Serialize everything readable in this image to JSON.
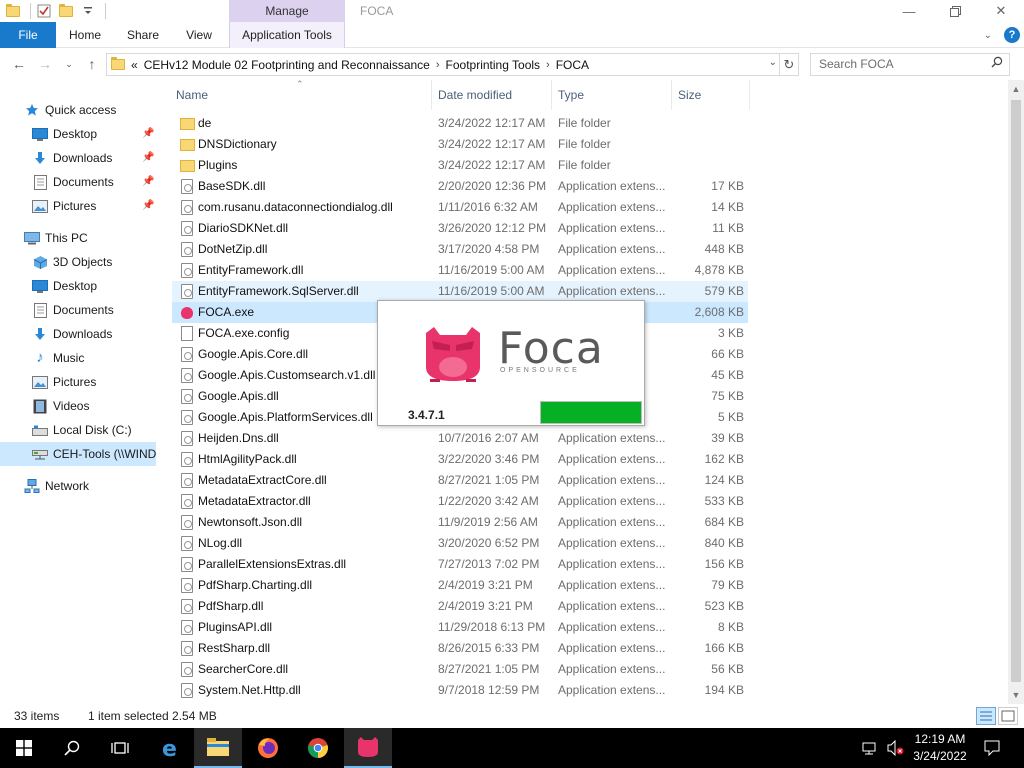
{
  "window": {
    "title": "FOCA",
    "manage_tab": "Manage",
    "controls": [
      "minimize-icon",
      "maximize-icon",
      "close-icon"
    ]
  },
  "ribbon": {
    "tabs": [
      "File",
      "Home",
      "Share",
      "View",
      "Application Tools"
    ]
  },
  "address": {
    "overflow": "«",
    "crumbs": [
      "CEHv12 Module 02 Footprinting and Reconnaissance",
      "Footprinting Tools",
      "FOCA"
    ],
    "search_placeholder": "Search FOCA"
  },
  "sidebar": {
    "quick_access": "Quick access",
    "quick_items": [
      "Desktop",
      "Downloads",
      "Documents",
      "Pictures"
    ],
    "this_pc": "This PC",
    "pc_items": [
      "3D Objects",
      "Desktop",
      "Documents",
      "Downloads",
      "Music",
      "Pictures",
      "Videos",
      "Local Disk (C:)",
      "CEH-Tools (\\\\WIND"
    ],
    "network": "Network"
  },
  "columns": [
    "Name",
    "Date modified",
    "Type",
    "Size"
  ],
  "files": [
    {
      "name": "de",
      "date": "3/24/2022 12:17 AM",
      "type": "File folder",
      "size": "",
      "kind": "folder"
    },
    {
      "name": "DNSDictionary",
      "date": "3/24/2022 12:17 AM",
      "type": "File folder",
      "size": "",
      "kind": "folder"
    },
    {
      "name": "Plugins",
      "date": "3/24/2022 12:17 AM",
      "type": "File folder",
      "size": "",
      "kind": "folder"
    },
    {
      "name": "BaseSDK.dll",
      "date": "2/20/2020 12:36 PM",
      "type": "Application extens...",
      "size": "17 KB",
      "kind": "dll"
    },
    {
      "name": "com.rusanu.dataconnectiondialog.dll",
      "date": "1/11/2016 6:32 AM",
      "type": "Application extens...",
      "size": "14 KB",
      "kind": "dll"
    },
    {
      "name": "DiarioSDKNet.dll",
      "date": "3/26/2020 12:12 PM",
      "type": "Application extens...",
      "size": "11 KB",
      "kind": "dll"
    },
    {
      "name": "DotNetZip.dll",
      "date": "3/17/2020 4:58 PM",
      "type": "Application extens...",
      "size": "448 KB",
      "kind": "dll"
    },
    {
      "name": "EntityFramework.dll",
      "date": "11/16/2019 5:00 AM",
      "type": "Application extens...",
      "size": "4,878 KB",
      "kind": "dll"
    },
    {
      "name": "EntityFramework.SqlServer.dll",
      "date": "11/16/2019 5:00 AM",
      "type": "Application extens...",
      "size": "579 KB",
      "kind": "dll",
      "state": "hover"
    },
    {
      "name": "FOCA.exe",
      "date": "",
      "type": "",
      "size": "2,608 KB",
      "kind": "exe",
      "state": "selected"
    },
    {
      "name": "FOCA.exe.config",
      "date": "",
      "type": "",
      "size": "3 KB",
      "kind": "config"
    },
    {
      "name": "Google.Apis.Core.dll",
      "date": "",
      "type": "ens...",
      "size": "66 KB",
      "kind": "dll"
    },
    {
      "name": "Google.Apis.Customsearch.v1.dll",
      "date": "",
      "type": "ens...",
      "size": "45 KB",
      "kind": "dll"
    },
    {
      "name": "Google.Apis.dll",
      "date": "",
      "type": "ens...",
      "size": "75 KB",
      "kind": "dll"
    },
    {
      "name": "Google.Apis.PlatformServices.dll",
      "date": "",
      "type": "ens...",
      "size": "5 KB",
      "kind": "dll"
    },
    {
      "name": "Heijden.Dns.dll",
      "date": "10/7/2016 2:07 AM",
      "type": "Application extens...",
      "size": "39 KB",
      "kind": "dll"
    },
    {
      "name": "HtmlAgilityPack.dll",
      "date": "3/22/2020 3:46 PM",
      "type": "Application extens...",
      "size": "162 KB",
      "kind": "dll"
    },
    {
      "name": "MetadataExtractCore.dll",
      "date": "8/27/2021 1:05 PM",
      "type": "Application extens...",
      "size": "124 KB",
      "kind": "dll"
    },
    {
      "name": "MetadataExtractor.dll",
      "date": "1/22/2020 3:42 AM",
      "type": "Application extens...",
      "size": "533 KB",
      "kind": "dll"
    },
    {
      "name": "Newtonsoft.Json.dll",
      "date": "11/9/2019 2:56 AM",
      "type": "Application extens...",
      "size": "684 KB",
      "kind": "dll"
    },
    {
      "name": "NLog.dll",
      "date": "3/20/2020 6:52 PM",
      "type": "Application extens...",
      "size": "840 KB",
      "kind": "dll"
    },
    {
      "name": "ParallelExtensionsExtras.dll",
      "date": "7/27/2013 7:02 PM",
      "type": "Application extens...",
      "size": "156 KB",
      "kind": "dll"
    },
    {
      "name": "PdfSharp.Charting.dll",
      "date": "2/4/2019 3:21 PM",
      "type": "Application extens...",
      "size": "79 KB",
      "kind": "dll"
    },
    {
      "name": "PdfSharp.dll",
      "date": "2/4/2019 3:21 PM",
      "type": "Application extens...",
      "size": "523 KB",
      "kind": "dll"
    },
    {
      "name": "PluginsAPI.dll",
      "date": "11/29/2018 6:13 PM",
      "type": "Application extens...",
      "size": "8 KB",
      "kind": "dll"
    },
    {
      "name": "RestSharp.dll",
      "date": "8/26/2015 6:33 PM",
      "type": "Application extens...",
      "size": "166 KB",
      "kind": "dll"
    },
    {
      "name": "SearcherCore.dll",
      "date": "8/27/2021 1:05 PM",
      "type": "Application extens...",
      "size": "56 KB",
      "kind": "dll"
    },
    {
      "name": "System.Net.Http.dll",
      "date": "9/7/2018 12:59 PM",
      "type": "Application extens...",
      "size": "194 KB",
      "kind": "dll"
    }
  ],
  "status": {
    "items": "33 items",
    "selected": "1 item selected  2.54 MB"
  },
  "splash": {
    "brand": "Foca",
    "subtitle": "OPENSOURCE",
    "version": "3.4.7.1",
    "progress": 1.0,
    "progress_color": "#06b025",
    "logo_color": "#e8336b"
  },
  "taskbar": {
    "apps": [
      "start-icon",
      "search-icon",
      "task-view-icon",
      "edge-icon",
      "file-explorer-icon",
      "firefox-icon",
      "chrome-icon",
      "foca-icon"
    ],
    "clock_time": "12:19 AM",
    "clock_date": "3/24/2022"
  },
  "colors": {
    "accent": "#1979ca",
    "selection": "#cce8ff",
    "hover": "#e5f3ff",
    "manage_tab": "#dcd2f0"
  }
}
